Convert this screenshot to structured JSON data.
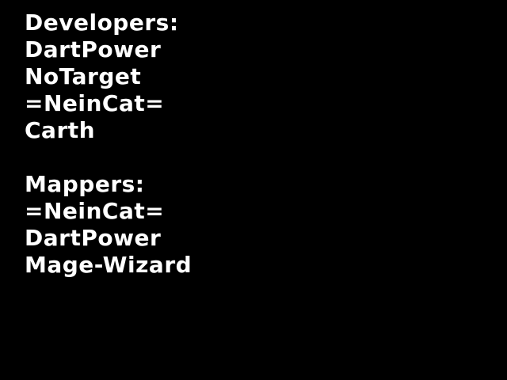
{
  "credits": {
    "developers": {
      "title": "Developers:",
      "names": [
        "DartPower",
        "NoTarget",
        "=NeinCat=",
        "Carth"
      ]
    },
    "mappers": {
      "title": "Mappers:",
      "names": [
        "=NeinCat=",
        "DartPower",
        "Mage-Wizard"
      ]
    }
  },
  "colors": {
    "background": "#000000",
    "text": "#ffffff"
  }
}
